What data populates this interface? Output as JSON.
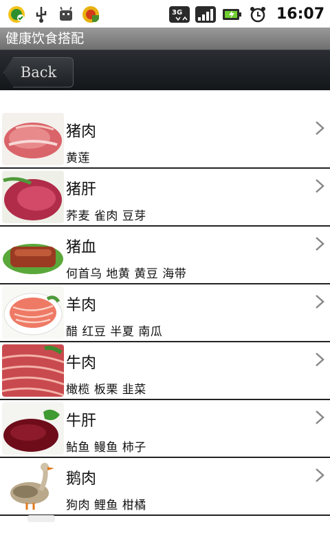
{
  "status_bar": {
    "time": "16:07",
    "network_label": "3G"
  },
  "app": {
    "title": "健康饮食搭配"
  },
  "nav": {
    "back_label": "Back"
  },
  "items": [
    {
      "name": "猪肉",
      "pairs": "黄莲",
      "image": "pork-photo"
    },
    {
      "name": "猪肝",
      "pairs": "荞麦 雀肉 豆芽",
      "image": "pork-liver-photo"
    },
    {
      "name": "猪血",
      "pairs": "何首乌 地黄 黄豆 海带",
      "image": "pig-blood-photo"
    },
    {
      "name": "羊肉",
      "pairs": "醋 红豆 半夏 南瓜",
      "image": "mutton-photo"
    },
    {
      "name": "牛肉",
      "pairs": "橄榄 板栗 韭菜",
      "image": "beef-photo"
    },
    {
      "name": "牛肝",
      "pairs": "鲇鱼 鳗鱼 柿子",
      "image": "beef-liver-photo"
    },
    {
      "name": "鹅肉",
      "pairs": "狗肉 鲤鱼 柑橘",
      "image": "goose-photo"
    }
  ],
  "colors": {
    "status_bar_bg": "#ffffff",
    "title_bar_bg": "#808080",
    "nav_bar_bg": "#1b1e21",
    "list_bg": "#ffffff",
    "divider": "#222222"
  }
}
